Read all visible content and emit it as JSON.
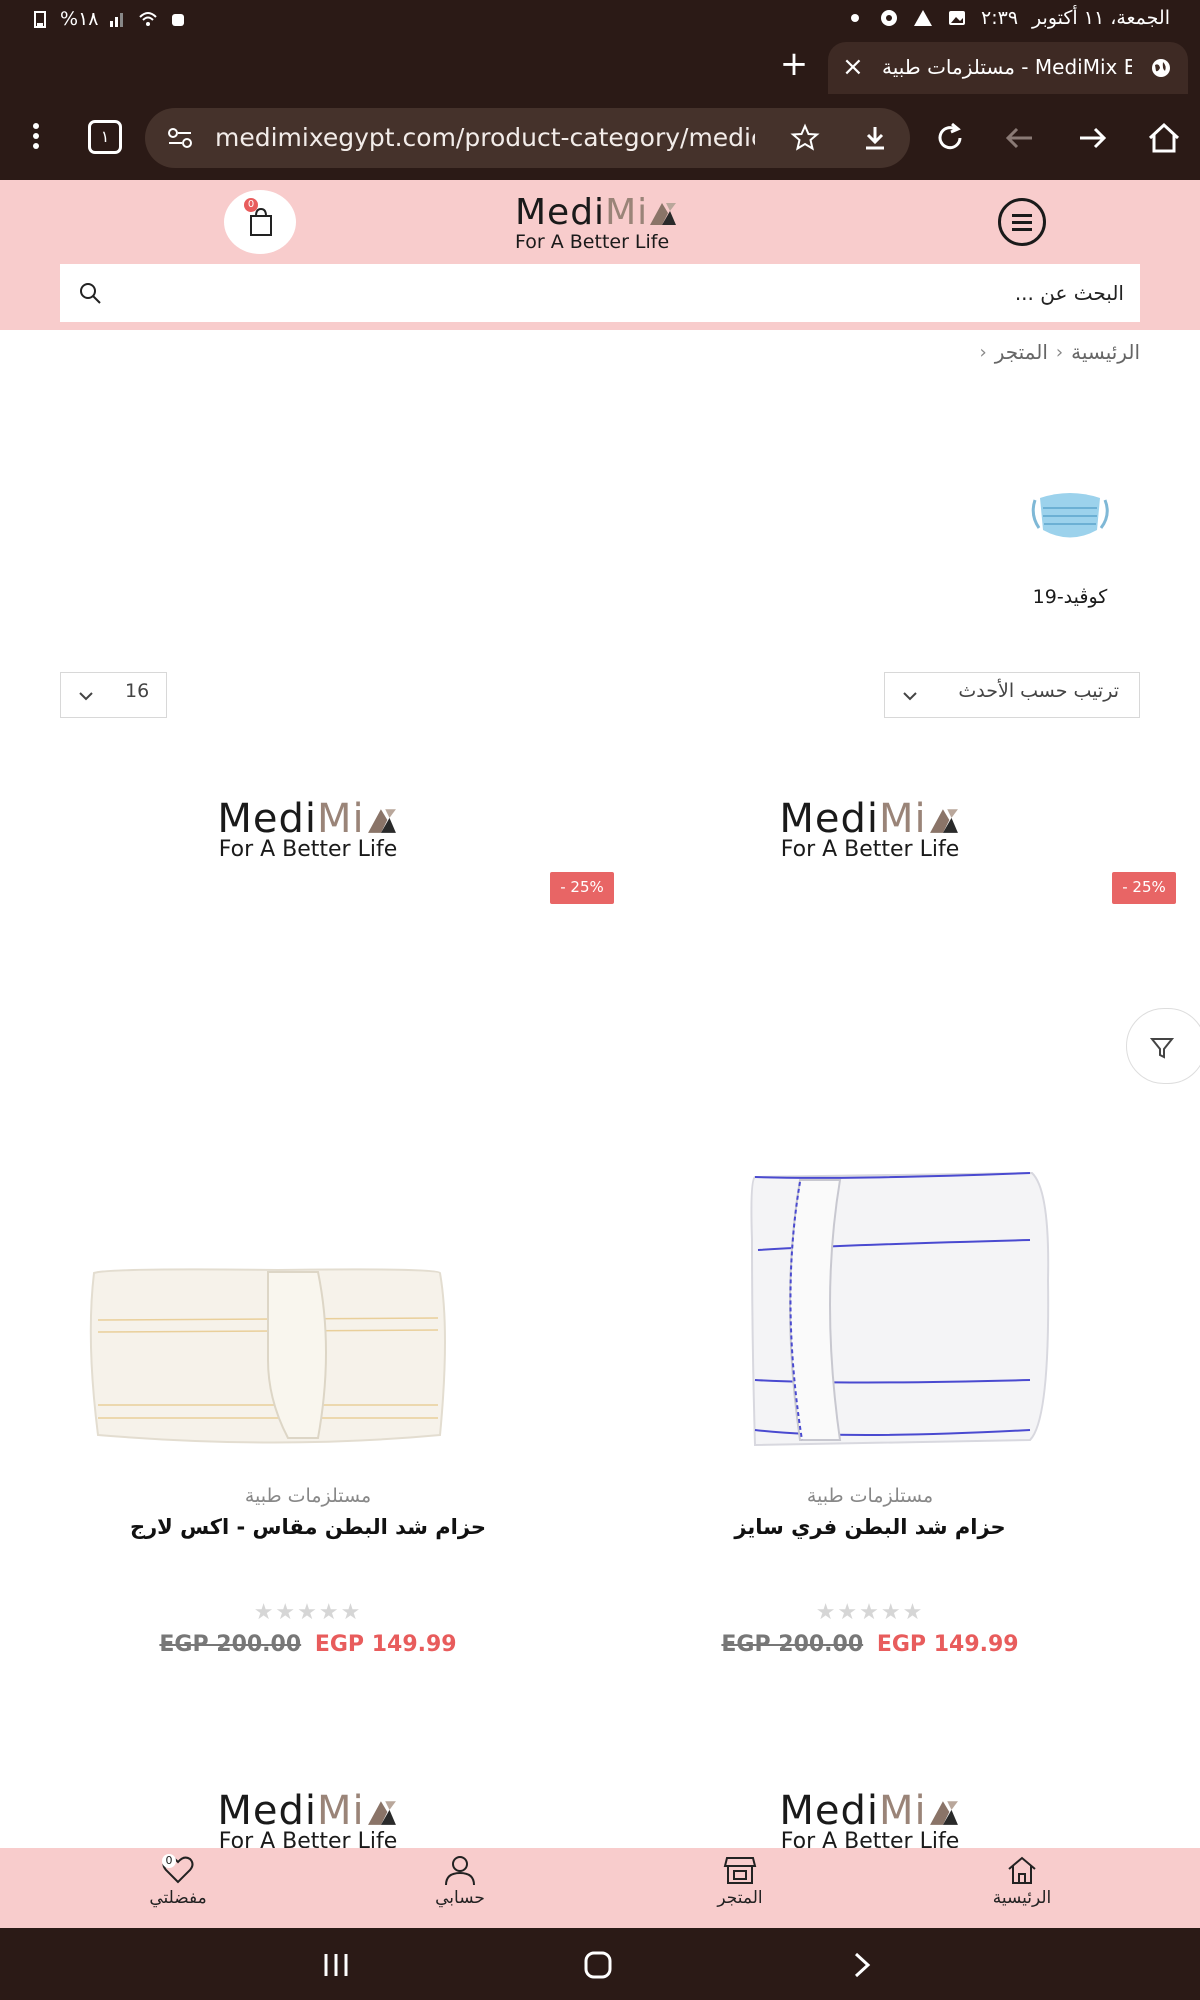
{
  "status_bar": {
    "date": "الجمعة، ١١ أكتوبر",
    "time": "٢:٣٩",
    "battery": "%١٨"
  },
  "browser": {
    "tab_title": "مستلزمات طبية - MediMix Egypt",
    "url": "medimixegypt.com/product-category/medical-supplies/",
    "tab_count": "١"
  },
  "header": {
    "logo_main_1": "Medi",
    "logo_main_2": "Mi",
    "logo_main_3": "x",
    "logo_tagline": "For A Better Life",
    "cart_count": "0",
    "search_placeholder": "البحث عن ..."
  },
  "breadcrumb": {
    "home": "الرئيسية",
    "shop": "المتجر"
  },
  "categories": [
    {
      "label": "كوڤيد-19",
      "icon": "face-mask-icon"
    }
  ],
  "toolbar": {
    "sort_label": "ترتيب حسب الأحدث",
    "per_page": "16"
  },
  "products": [
    {
      "category": "مستلزمات طبية",
      "name": "حزام شد البطن فري سايز",
      "badge": "- 25%",
      "price_new": "EGP 149.99",
      "price_old": "EGP 200.00",
      "rating": 0
    },
    {
      "category": "مستلزمات طبية",
      "name": "حزام شد البطن مقاس - اكس لارج",
      "badge": "- 25%",
      "price_new": "EGP 149.99",
      "price_old": "EGP 200.00",
      "rating": 0
    }
  ],
  "bottom_nav": {
    "home": "الرئيسية",
    "shop": "المتجر",
    "account": "حسابي",
    "wishlist": "مفضلتي",
    "wishlist_count": "0"
  },
  "colors": {
    "header_bg": "#f8cccc",
    "browser_bg": "#2b1a16",
    "sale_red": "#e85c5c"
  }
}
